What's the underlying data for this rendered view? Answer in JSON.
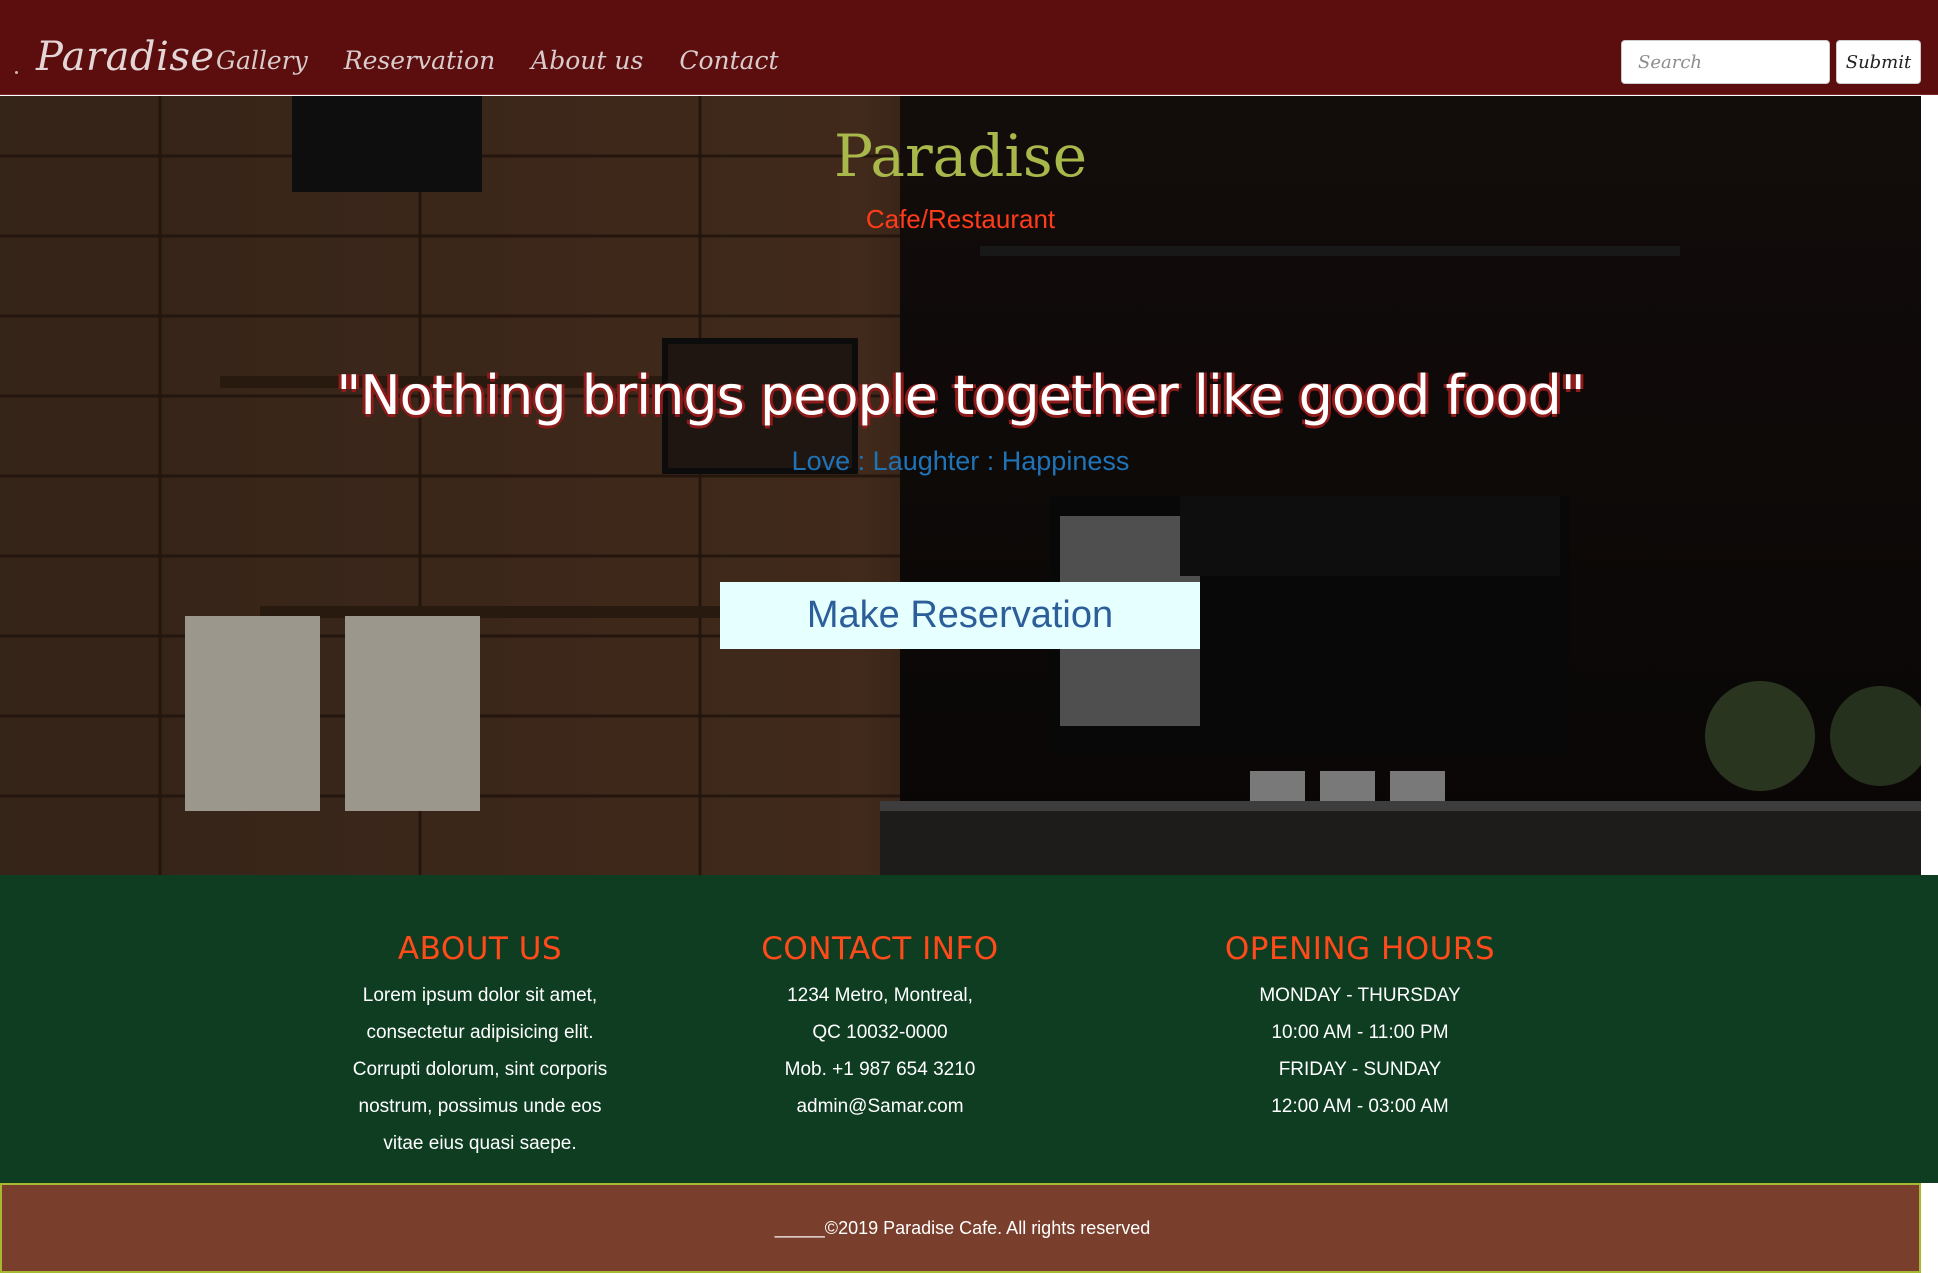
{
  "navbar": {
    "brand": "Paradise",
    "links": [
      "Gallery",
      "Reservation",
      "About us",
      "Contact"
    ],
    "search_placeholder": "Search",
    "submit_label": "Submit"
  },
  "hero": {
    "title": "Paradise",
    "subtitle": "Cafe/Restaurant",
    "quote": "\"Nothing brings people together like good food\"",
    "tagline": "Love : Laughter : Happiness",
    "reserve_label": "Make Reservation"
  },
  "about": {
    "title": "ABOUT US",
    "lines": [
      "Lorem ipsum dolor sit amet,",
      "consectetur adipisicing elit.",
      "Corrupti dolorum, sint corporis",
      "nostrum, possimus unde eos",
      "vitae eius quasi saepe."
    ]
  },
  "contact": {
    "title": "CONTACT INFO",
    "lines": [
      "1234 Metro, Montreal,",
      "QC 10032-0000",
      "Mob. +1 987 654 3210",
      "admin@Samar.com"
    ]
  },
  "hours": {
    "title": "OPENING HOURS",
    "lines": [
      "MONDAY - THURSDAY",
      "10:00 AM - 11:00 PM",
      "FRIDAY - SUNDAY",
      "12:00 AM - 03:00 AM"
    ]
  },
  "footer": {
    "text": "_____©2019 Paradise Cafe. All rights reserved"
  },
  "colors": {
    "navbar_bg": "#5c0e0e",
    "hero_title": "#a8b84a",
    "hero_subtitle": "#ff3b1a",
    "tagline": "#1f73b7",
    "reserve_bg": "#e6ffff",
    "info_bg": "#0f3d22",
    "info_heading": "#ff4a1a",
    "footer_bg": "#7a3f2c",
    "footer_border": "#a6b832"
  }
}
